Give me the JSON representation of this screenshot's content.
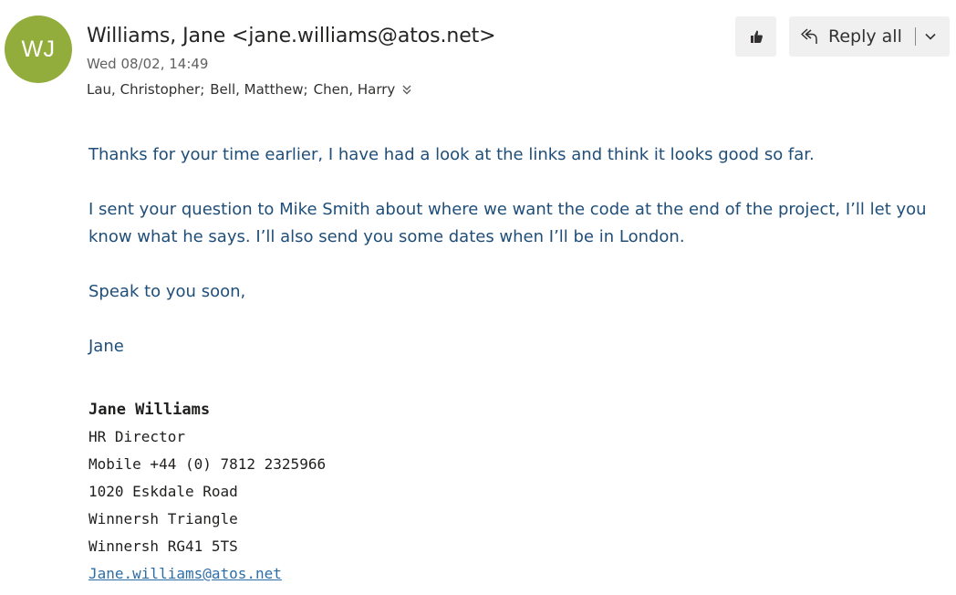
{
  "message": {
    "sender": {
      "initials": "WJ",
      "display": "Williams, Jane <jane.williams@atos.net>",
      "avatar_color": "#93ad3d"
    },
    "date": "Wed 08/02, 14:49",
    "recipients": [
      "Lau, Christopher;",
      "Bell, Matthew;",
      "Chen, Harry"
    ],
    "actions": {
      "like_icon": "thumbs-up-icon",
      "reply_all_label": "Reply all",
      "reply_icon": "reply-all-icon",
      "more_icon": "chevron-down-icon",
      "expand_icon": "double-chevron-down-icon"
    },
    "body": [
      "Thanks for your time earlier, I have had a look at the links and think it looks good so far.",
      "I sent your question to Mike Smith about where we want the code at the end of the project, I’ll let you know what he says.  I’ll also send you some dates when I’ll be in London.",
      "Speak to you soon,",
      "Jane"
    ],
    "signature": {
      "name": "Jane Williams",
      "title": "HR Director",
      "mobile": "Mobile +44 (0) 7812 2325966",
      "address_line1": "1020 Eskdale Road",
      "address_line2": "Winnersh Triangle",
      "address_line3": "Winnersh RG41 5TS",
      "email": "Jane.williams@atos.net"
    },
    "colors": {
      "body_text": "#1f4e79",
      "link": "#2e6ea7",
      "button_bg": "#f0f0f0"
    }
  }
}
